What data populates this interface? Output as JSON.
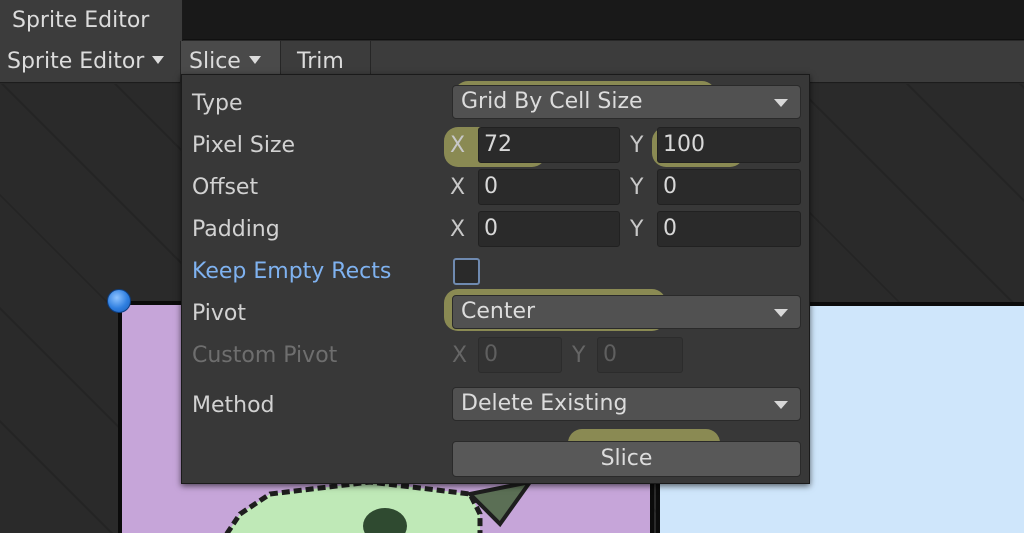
{
  "window": {
    "tab_title": "Sprite Editor"
  },
  "toolbar": {
    "sprite_editor_label": "Sprite Editor",
    "slice_label": "Slice",
    "trim_label": "Trim"
  },
  "slice_popup": {
    "type": {
      "label": "Type",
      "value": "Grid By Cell Size"
    },
    "pixel_size": {
      "label": "Pixel Size",
      "x_axis": "X",
      "x_value": "72",
      "y_axis": "Y",
      "y_value": "100"
    },
    "offset": {
      "label": "Offset",
      "x_axis": "X",
      "x_value": "0",
      "y_axis": "Y",
      "y_value": "0"
    },
    "padding": {
      "label": "Padding",
      "x_axis": "X",
      "x_value": "0",
      "y_axis": "Y",
      "y_value": "0"
    },
    "keep_empty_rects": {
      "label": "Keep Empty Rects",
      "checked": false
    },
    "pivot": {
      "label": "Pivot",
      "value": "Center"
    },
    "custom_pivot": {
      "label": "Custom Pivot",
      "x_axis": "X",
      "x_value": "0",
      "y_axis": "Y",
      "y_value": "0",
      "disabled": true
    },
    "method": {
      "label": "Method",
      "value": "Delete Existing"
    },
    "slice_button_label": "Slice"
  },
  "colors": {
    "highlight": "#cdcd69",
    "link_label": "#7fb2f0",
    "sprite_purple": "#c6a5d9",
    "sprite_blue": "#cfe6fb",
    "handle": "#2f7fe0"
  }
}
